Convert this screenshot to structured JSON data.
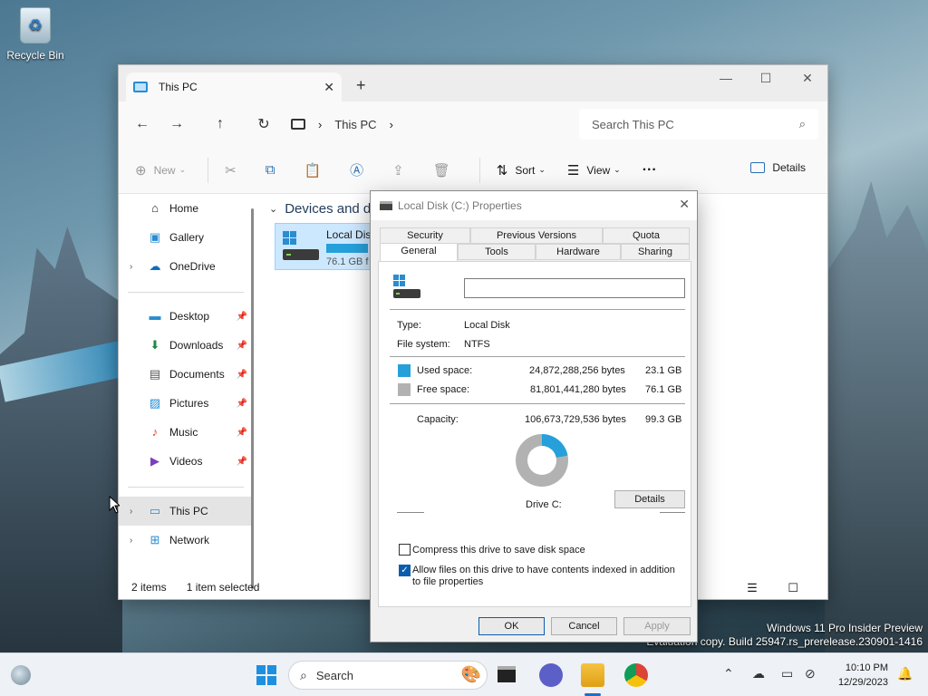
{
  "desktop": {
    "recycle_bin_label": "Recycle Bin",
    "watermark_line1": "Windows 11 Pro Insider Preview",
    "watermark_line2": "Evaluation copy. Build 25947.rs_prerelease.230901-1416"
  },
  "explorer": {
    "tab_title": "This PC",
    "breadcrumb": "This PC",
    "search_placeholder": "Search This PC",
    "toolbar": {
      "new_label": "New",
      "sort_label": "Sort",
      "view_label": "View",
      "details_label": "Details"
    },
    "sidebar": {
      "items": [
        {
          "label": "Home",
          "icon": "home-icon"
        },
        {
          "label": "Gallery",
          "icon": "gallery-icon"
        },
        {
          "label": "OneDrive",
          "icon": "cloud-icon"
        },
        {
          "label": "Desktop",
          "icon": "desktop-folder-icon"
        },
        {
          "label": "Downloads",
          "icon": "download-icon"
        },
        {
          "label": "Documents",
          "icon": "documents-icon"
        },
        {
          "label": "Pictures",
          "icon": "pictures-icon"
        },
        {
          "label": "Music",
          "icon": "music-icon"
        },
        {
          "label": "Videos",
          "icon": "videos-icon"
        },
        {
          "label": "This PC",
          "icon": "pc-icon"
        },
        {
          "label": "Network",
          "icon": "network-icon"
        }
      ]
    },
    "section_title": "Devices and dr",
    "drive": {
      "name": "Local Dis",
      "free": "76.1 GB f",
      "used_fraction": 0.23
    },
    "status": {
      "count": "2 items",
      "selected": "1 item selected"
    }
  },
  "dialog": {
    "title": "Local Disk (C:) Properties",
    "tabs_row1": [
      "Security",
      "Previous Versions",
      "Quota"
    ],
    "tabs_row2": [
      "General",
      "Tools",
      "Hardware",
      "Sharing"
    ],
    "active_tab": "General",
    "drive_name_value": "",
    "type_label": "Type:",
    "type_value": "Local Disk",
    "fs_label": "File system:",
    "fs_value": "NTFS",
    "used_label": "Used space:",
    "used_bytes": "24,872,288,256 bytes",
    "used_gb": "23.1 GB",
    "free_label": "Free space:",
    "free_bytes": "81,801,441,280 bytes",
    "free_gb": "76.1 GB",
    "capacity_label": "Capacity:",
    "capacity_bytes": "106,673,729,536 bytes",
    "capacity_gb": "99.3 GB",
    "drive_label": "Drive C:",
    "details_button": "Details",
    "compress_label": "Compress this drive to save disk space",
    "compress_checked": false,
    "index_label": "Allow files on this drive to have contents indexed in addition to file properties",
    "index_checked": true,
    "ok_label": "OK",
    "cancel_label": "Cancel",
    "apply_label": "Apply",
    "colors": {
      "used": "#26a0da",
      "free": "#b2b2b2"
    }
  },
  "taskbar": {
    "search_label": "Search",
    "time": "10:10 PM",
    "date": "12/29/2023"
  }
}
